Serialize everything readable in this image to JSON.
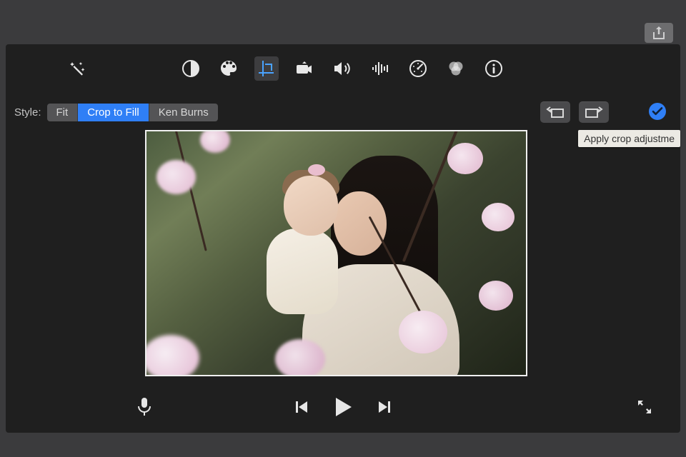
{
  "style": {
    "label": "Style:",
    "options": [
      "Fit",
      "Crop to Fill",
      "Ken Burns"
    ],
    "selected": "Crop to Fill"
  },
  "tooltip": {
    "apply_crop": "Apply crop adjustme"
  },
  "toolbar": {
    "items": [
      {
        "name": "color-balance"
      },
      {
        "name": "color-correction"
      },
      {
        "name": "crop",
        "active": true
      },
      {
        "name": "stabilization"
      },
      {
        "name": "volume"
      },
      {
        "name": "noise-reduction"
      },
      {
        "name": "speed"
      },
      {
        "name": "color-filters"
      },
      {
        "name": "info"
      }
    ]
  },
  "playback": {
    "prev": "Previous",
    "play": "Play",
    "next": "Next"
  },
  "rotate": {
    "ccw": "Rotate CCW",
    "cw": "Rotate CW"
  },
  "actions": {
    "apply": "Apply",
    "share": "Share",
    "enhance": "Auto Enhance",
    "mic": "Voiceover",
    "fullscreen": "Fullscreen"
  }
}
